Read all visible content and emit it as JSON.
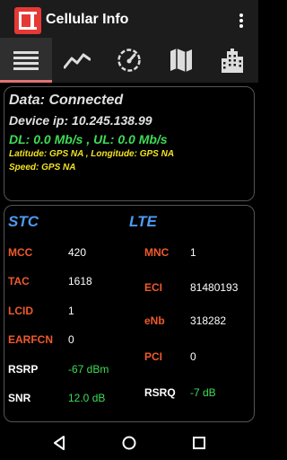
{
  "app": {
    "title": "Cellular Info"
  },
  "tabs": [
    {
      "name": "list",
      "icon": "list-icon",
      "active": true
    },
    {
      "name": "graph",
      "icon": "line-chart-icon",
      "active": false
    },
    {
      "name": "speed",
      "icon": "speedometer-icon",
      "active": false
    },
    {
      "name": "map",
      "icon": "map-icon",
      "active": false
    },
    {
      "name": "towers",
      "icon": "building-icon",
      "active": false
    }
  ],
  "connection": {
    "status": "Data: Connected",
    "ip": "Device ip: 10.245.138.99",
    "speed": "DL: 0.0 Mb/s , UL: 0.0 Mb/s",
    "location": "Latitude: GPS NA  , Longitude: GPS NA",
    "gps_speed": "Speed: GPS NA"
  },
  "cell": {
    "operator": "STC",
    "network": "LTE",
    "left": [
      {
        "label": "MCC",
        "value": "420"
      },
      {
        "label": "TAC",
        "value": "1618"
      },
      {
        "label": "LCID",
        "value": "1"
      },
      {
        "label": "EARFCN",
        "value": "0"
      },
      {
        "label": "RSRP",
        "value": "-67 dBm"
      },
      {
        "label": "SNR",
        "value": "12.0 dB"
      }
    ],
    "right": [
      {
        "label": "MNC",
        "value": "1"
      },
      {
        "label": "ECI",
        "value": "81480193"
      },
      {
        "label": "eNb",
        "value": "318282"
      },
      {
        "label": "PCI",
        "value": "0"
      },
      {
        "label": "RSRQ",
        "value": "-7 dB"
      }
    ]
  },
  "colors": {
    "label": "#ef5a2a",
    "good": "#3ddc56",
    "location": "#f2e21f",
    "operator": "#4d9bf0",
    "tab_indicator": "#e57373",
    "logo": "#e53935"
  }
}
